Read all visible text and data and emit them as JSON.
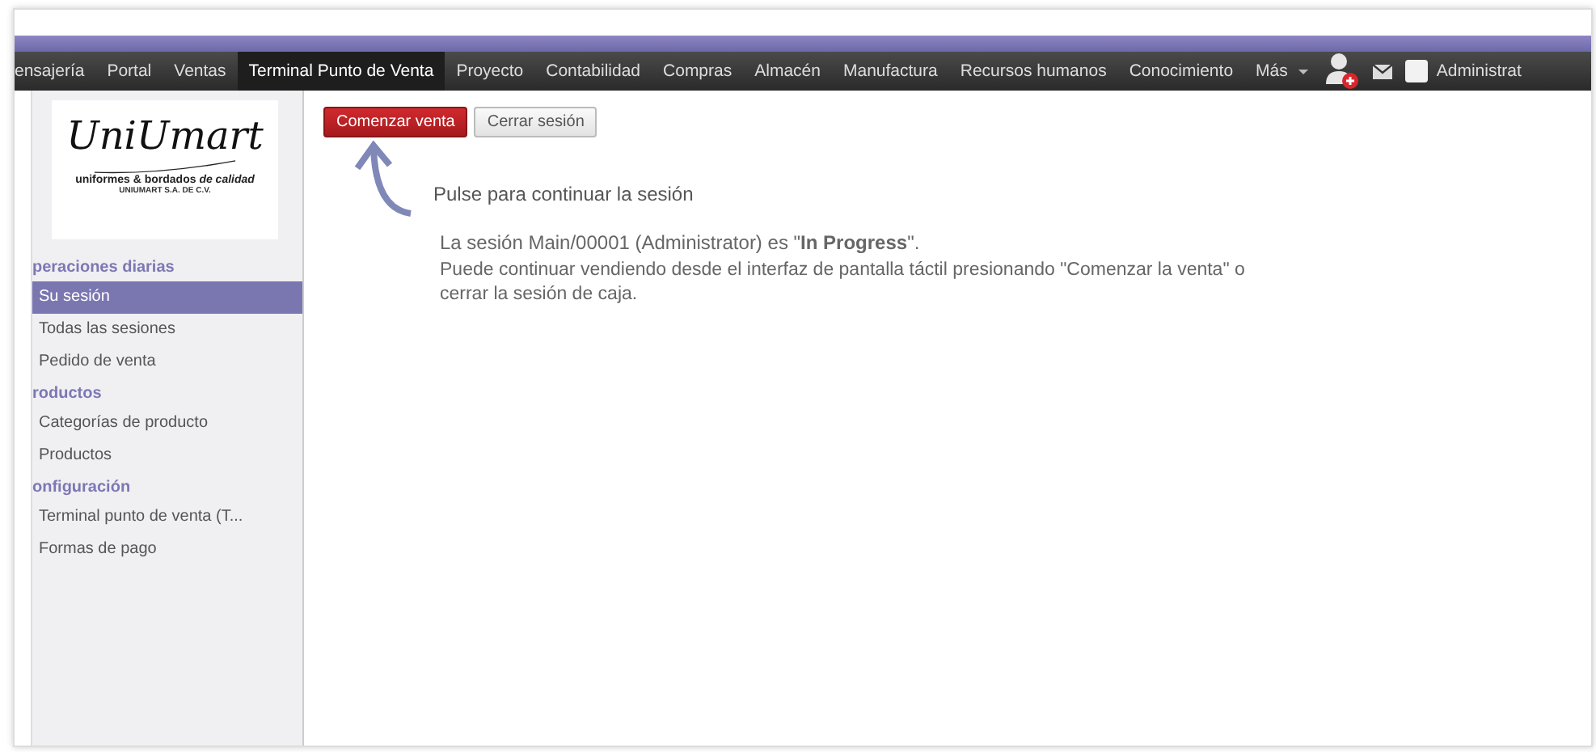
{
  "menu": [
    {
      "label": "ensajería",
      "selected": false
    },
    {
      "label": "Portal",
      "selected": false
    },
    {
      "label": "Ventas",
      "selected": false
    },
    {
      "label": "Terminal Punto de Venta",
      "selected": true
    },
    {
      "label": "Proyecto",
      "selected": false
    },
    {
      "label": "Contabilidad",
      "selected": false
    },
    {
      "label": "Compras",
      "selected": false
    },
    {
      "label": "Almacén",
      "selected": false
    },
    {
      "label": "Manufactura",
      "selected": false
    },
    {
      "label": "Recursos humanos",
      "selected": false
    },
    {
      "label": "Conocimiento",
      "selected": false
    },
    {
      "label": "Más",
      "selected": false
    }
  ],
  "user": {
    "name": "Administrat"
  },
  "logo": {
    "brand": "UniUmart",
    "tagline": "uniformes & bordados *de calidad*",
    "company": "UNIUMART S.A. DE C.V."
  },
  "sidebar": [
    {
      "heading": "peraciones diarias",
      "items": [
        {
          "label": "Su sesión",
          "selected": true
        },
        {
          "label": "Todas las sesiones",
          "selected": false
        },
        {
          "label": "Pedido de venta",
          "selected": false
        }
      ]
    },
    {
      "heading": "roductos",
      "items": [
        {
          "label": "Categorías de producto",
          "selected": false
        },
        {
          "label": "Productos",
          "selected": false
        }
      ]
    },
    {
      "heading": "onfiguración",
      "items": [
        {
          "label": "Terminal punto de venta (T...",
          "selected": false
        },
        {
          "label": "Formas de pago",
          "selected": false
        }
      ]
    }
  ],
  "buttons": [
    {
      "label": "Comenzar venta",
      "kind": "primary"
    },
    {
      "label": "Cerrar sesión",
      "kind": "secondary"
    }
  ],
  "hint": "Pulse para continuar la sesión",
  "status": "La sesión Main/00001 (Administrator) es \"**In Progress**\".",
  "message": "Puede continuar vendiendo desde el interfaz de pantalla táctil presionando \"Comenzar la venta\" o cerrar la sesión de caja."
}
